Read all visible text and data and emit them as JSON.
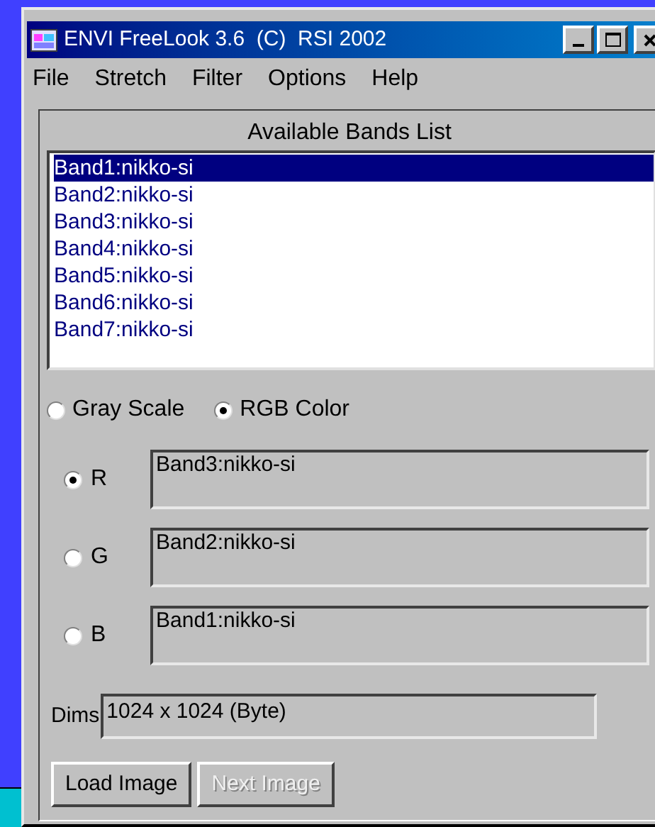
{
  "window": {
    "title": "ENVI FreeLook 3.6  (C)  RSI 2002"
  },
  "menu": [
    "File",
    "Stretch",
    "Filter",
    "Options",
    "Help"
  ],
  "bands_list": {
    "title": "Available Bands List",
    "items": [
      {
        "label": "Band1:nikko-si",
        "selected": true
      },
      {
        "label": "Band2:nikko-si",
        "selected": false
      },
      {
        "label": "Band3:nikko-si",
        "selected": false
      },
      {
        "label": "Band4:nikko-si",
        "selected": false
      },
      {
        "label": "Band5:nikko-si",
        "selected": false
      },
      {
        "label": "Band6:nikko-si",
        "selected": false
      },
      {
        "label": "Band7:nikko-si",
        "selected": false
      }
    ]
  },
  "modes": [
    {
      "label": "Gray Scale",
      "selected": false
    },
    {
      "label": "RGB Color",
      "selected": true
    }
  ],
  "channels": [
    {
      "label": "R",
      "selected": true,
      "value": "Band3:nikko-si"
    },
    {
      "label": "G",
      "selected": false,
      "value": "Band2:nikko-si"
    },
    {
      "label": "B",
      "selected": false,
      "value": "Band1:nikko-si"
    }
  ],
  "dims": {
    "label": "Dims",
    "value": "1024 x 1024 (Byte)"
  },
  "buttons": [
    {
      "label": "Load Image",
      "disabled": false
    },
    {
      "label": "Next Image",
      "disabled": true
    }
  ]
}
